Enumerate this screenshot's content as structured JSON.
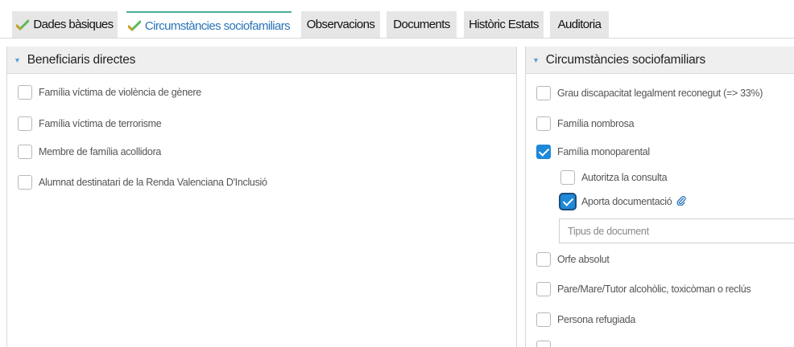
{
  "tabs": [
    {
      "label": "Dades bàsiques",
      "checked": true
    },
    {
      "label": "Circumstàncies sociofamiliars",
      "checked": true,
      "active": true
    },
    {
      "label": "Observacions"
    },
    {
      "label": "Documents"
    },
    {
      "label": "Històric Estats"
    },
    {
      "label": "Auditoria"
    }
  ],
  "left_panel": {
    "title": "Beneficiaris directes",
    "items": [
      {
        "label": "Família víctima de violència de gènere",
        "checked": false
      },
      {
        "label": "Família víctima de terrorisme",
        "checked": false
      },
      {
        "label": "Membre de família acollidora",
        "checked": false
      },
      {
        "label": "Alumnat destinatari de la Renda Valenciana D'Inclusió",
        "checked": false
      }
    ]
  },
  "right_panel": {
    "title": "Circumstàncies sociofamiliars",
    "items": [
      {
        "label": "Grau discapacitat legalment reconegut (=> 33%)",
        "checked": false
      },
      {
        "label": "Família nombrosa",
        "checked": false
      },
      {
        "label": "Família monoparental",
        "checked": true
      },
      {
        "label": "Autoritza la consulta",
        "checked": false
      },
      {
        "label": "Aporta documentació",
        "checked": true
      },
      {
        "label": "Orfe absolut",
        "checked": false
      },
      {
        "label": "Pare/Mare/Tutor alcohòlic, toxicòman o reclús",
        "checked": false
      },
      {
        "label": "Persona refugiada",
        "checked": false
      }
    ],
    "document_type_placeholder": "Tipus de document"
  },
  "colors": {
    "accent": "#1e88d9",
    "tab_check": "#5cb85c",
    "tab_active_text": "#2a74b8"
  }
}
